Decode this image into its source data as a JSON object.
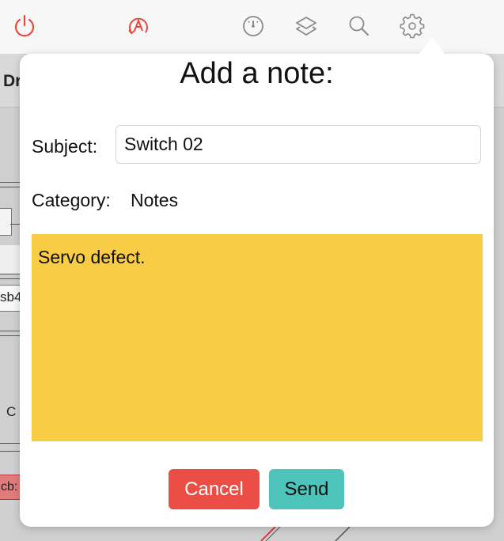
{
  "toolbar": {
    "icons": [
      "power-icon",
      "auto-mode-icon",
      "speedometer-icon",
      "layers-icon",
      "search-icon",
      "gear-icon"
    ],
    "accent_color": "#e8473d",
    "icon_color": "#8a8a8a"
  },
  "background": {
    "title": "Dr",
    "items": [
      "sb4",
      "C",
      "cb:"
    ]
  },
  "dialog": {
    "title": "Add a note:",
    "subject_label": "Subject:",
    "subject_value": "Switch 02",
    "category_label": "Category:",
    "category_value": "Notes",
    "note_text": "Servo defect.",
    "note_color": "#f8cc44",
    "cancel_label": "Cancel",
    "send_label": "Send",
    "cancel_color": "#ea4e44",
    "send_color": "#4ec3b9"
  }
}
